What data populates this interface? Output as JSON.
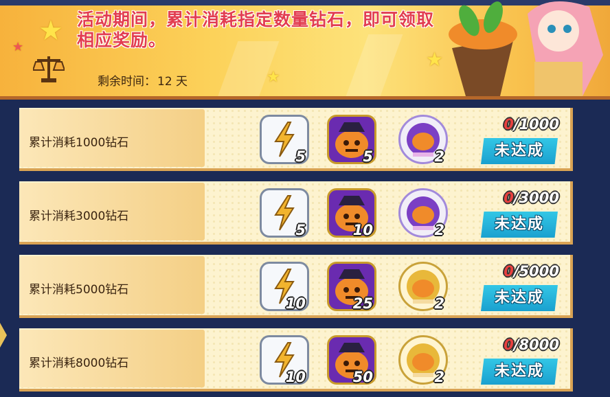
{
  "banner": {
    "description": "活动期间，累计消耗指定数量钻石，即可领取相应奖励。",
    "remaining_label": "剩余时间：",
    "remaining_value": "12 天"
  },
  "rows": [
    {
      "label": "累计消耗1000钻石",
      "items": [
        {
          "type": "energy-icon",
          "qty": "5"
        },
        {
          "type": "pumpkin-icon",
          "qty": "5"
        },
        {
          "type": "pumpkin-badge-icon",
          "qty": "2"
        }
      ],
      "progress_current": "0",
      "progress_total": "/1000",
      "status": "未达成"
    },
    {
      "label": "累计消耗3000钻石",
      "items": [
        {
          "type": "energy-icon",
          "qty": "5"
        },
        {
          "type": "pumpkin-icon",
          "qty": "10"
        },
        {
          "type": "pumpkin-badge-icon",
          "qty": "2"
        }
      ],
      "progress_current": "0",
      "progress_total": "/3000",
      "status": "未达成"
    },
    {
      "label": "累计消耗5000钻石",
      "items": [
        {
          "type": "energy-icon",
          "qty": "10"
        },
        {
          "type": "pumpkin-icon",
          "qty": "25"
        },
        {
          "type": "pumpkin-gold-badge-icon",
          "qty": "2"
        }
      ],
      "progress_current": "0",
      "progress_total": "/5000",
      "status": "未达成"
    },
    {
      "label": "累计消耗8000钻石",
      "items": [
        {
          "type": "energy-icon",
          "qty": "10"
        },
        {
          "type": "pumpkin-icon",
          "qty": "50"
        },
        {
          "type": "pumpkin-gold-badge-icon",
          "qty": "2"
        }
      ],
      "progress_current": "0",
      "progress_total": "/8000",
      "status": "未达成"
    }
  ],
  "colors": {
    "accent_red": "#e23d50",
    "button_blue": "#1aa1cf",
    "banner_yellow": "#fcd25a"
  }
}
